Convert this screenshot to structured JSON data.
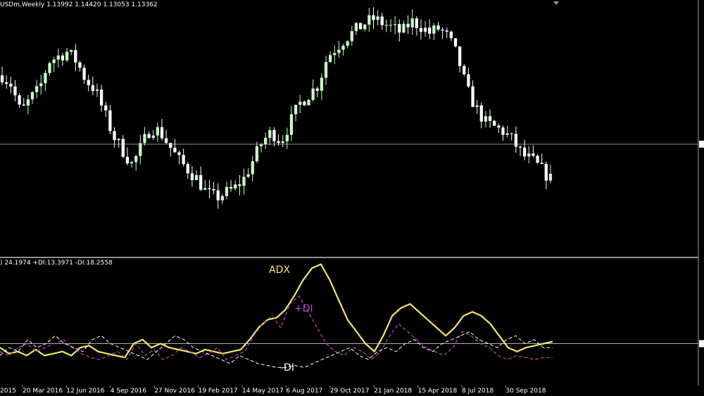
{
  "header": {
    "price_title": "USDm,Weekly  1.13992 1.14420 1.13053 1.13362",
    "indicator_title": ") 24.1974 +DI:13.3971 -DI:18.2558"
  },
  "colors": {
    "background": "#000000",
    "bull_candle": "#c8f7c5",
    "bear_candle": "#ffffff",
    "adx": "#f3e56b",
    "plus_di": "#b54bb5",
    "minus_di": "#ffffff",
    "level_line": "#c8c8c8"
  },
  "chart_data": [
    {
      "type": "candlestick",
      "title": "USDm,Weekly  1.13992 1.14420 1.13053 1.13362",
      "close_path": [
        0.74,
        0.7,
        0.58,
        0.64,
        0.68,
        0.8,
        0.82,
        0.84,
        0.8,
        0.72,
        0.68,
        0.58,
        0.48,
        0.42,
        0.36,
        0.44,
        0.52,
        0.5,
        0.44,
        0.38,
        0.34,
        0.3,
        0.24,
        0.22,
        0.24,
        0.26,
        0.3,
        0.38,
        0.46,
        0.5,
        0.46,
        0.54,
        0.62,
        0.66,
        0.7,
        0.82,
        0.86,
        0.9,
        0.93,
        0.96,
        0.98,
        0.96,
        0.94,
        0.92,
        0.97,
        0.95,
        0.92,
        0.94,
        0.9,
        0.82,
        0.68,
        0.6,
        0.54,
        0.52,
        0.5,
        0.46,
        0.4,
        0.38,
        0.34,
        0.3
      ],
      "current_price": 1.13362,
      "level_fraction": 0.5
    },
    {
      "type": "line",
      "title": ") 24.1974 +DI:13.3971 -DI:18.2558",
      "x": [
        "20 Mar 2016",
        "12 Jun 2016",
        "4 Sep 2016",
        "27 Nov 2016",
        "19 Feb 2017",
        "14 May 2017",
        "6 Aug 2017",
        "29 Oct 2017",
        "21 Jan 2018",
        "15 Apr 2018",
        "8 Jul 2018",
        "30 Sep 2018"
      ],
      "x_partial_first_label": "2015",
      "level": 20,
      "ylim": [
        0,
        62
      ],
      "series": [
        {
          "name": "ADX",
          "values": [
            18,
            15,
            16,
            14,
            17,
            14,
            15,
            16,
            14,
            18,
            19,
            16,
            15,
            14,
            13,
            20,
            22,
            18,
            20,
            18,
            17,
            16,
            15,
            17,
            16,
            15,
            16,
            17,
            22,
            28,
            32,
            33,
            37,
            44,
            52,
            58,
            60,
            52,
            42,
            32,
            26,
            20,
            16,
            24,
            34,
            38,
            40,
            36,
            32,
            28,
            24,
            28,
            34,
            36,
            34,
            30,
            24,
            18,
            16,
            18,
            19,
            20,
            21
          ]
        },
        {
          "name": "+DI",
          "values": [
            16,
            14,
            18,
            20,
            16,
            18,
            20,
            22,
            18,
            15,
            13,
            12,
            14,
            16,
            12,
            20,
            14,
            17,
            12,
            14,
            18,
            16,
            13,
            15,
            18,
            12,
            14,
            16,
            24,
            30,
            34,
            28,
            40,
            44,
            36,
            28,
            20,
            16,
            14,
            18,
            16,
            12,
            16,
            24,
            30,
            26,
            22,
            18,
            16,
            14,
            18,
            26,
            24,
            20,
            18,
            14,
            12,
            14,
            13,
            12,
            13,
            13
          ]
        },
        {
          "name": "-DI",
          "values": [
            14,
            18,
            16,
            22,
            18,
            20,
            24,
            20,
            18,
            16,
            22,
            24,
            20,
            18,
            16,
            14,
            12,
            16,
            20,
            24,
            22,
            18,
            16,
            14,
            12,
            10,
            14,
            12,
            10,
            9,
            8,
            8,
            9,
            8,
            10,
            12,
            14,
            16,
            18,
            14,
            12,
            16,
            18,
            16,
            20,
            22,
            18,
            16,
            20,
            22,
            24,
            26,
            22,
            20,
            18,
            22,
            24,
            20,
            22,
            18,
            18
          ]
        }
      ]
    }
  ]
}
